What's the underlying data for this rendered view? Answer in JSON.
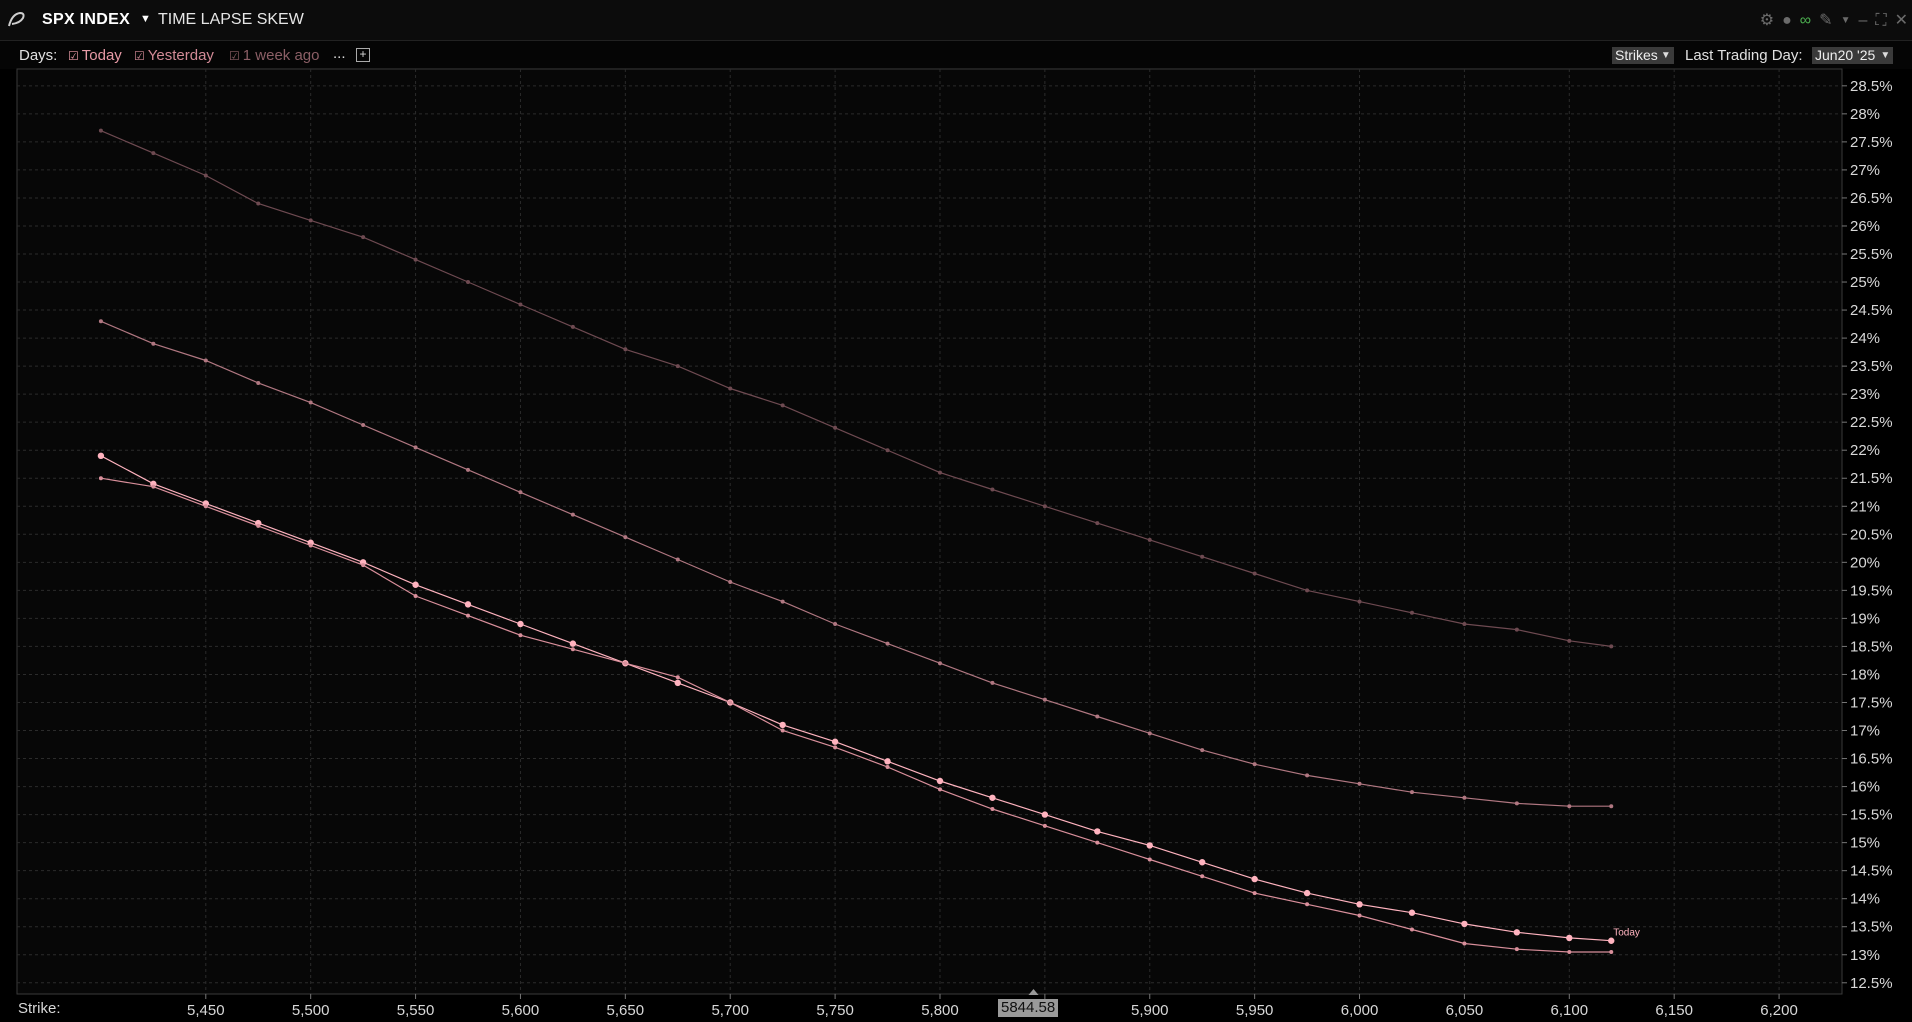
{
  "header": {
    "ticker": "SPX INDEX",
    "panel_title": "TIME LAPSE SKEW",
    "icons": [
      "gear-icon",
      "chat-icon",
      "link-icon",
      "pin-icon",
      "minimize-icon",
      "maximize-icon",
      "close-icon"
    ]
  },
  "toolbar": {
    "days_label": "Days:",
    "days": [
      {
        "label": "Today",
        "checked": true,
        "color": "#e89aa6"
      },
      {
        "label": "Yesterday",
        "checked": true,
        "color": "#d28a96"
      },
      {
        "label": "1 week ago",
        "checked": true,
        "color": "#8c5f66"
      }
    ],
    "more": "...",
    "add_symbol": "+",
    "axis_mode": "Strikes",
    "last_trading_day_label": "Last Trading Day:",
    "last_trading_day_value": "Jun20 '25"
  },
  "footer": {
    "x_axis_label": "Strike:",
    "cursor_value": "5844.58"
  },
  "chart_data": {
    "type": "line",
    "xlabel": "Strike:",
    "ylabel": "",
    "xlim": [
      5360,
      6230
    ],
    "ylim": [
      12.3,
      28.8
    ],
    "x_ticks": [
      5450,
      5500,
      5550,
      5600,
      5650,
      5700,
      5750,
      5800,
      5850,
      5900,
      5950,
      6000,
      6050,
      6100,
      6150,
      6200
    ],
    "x_tick_labels": [
      "5,450",
      "5,500",
      "5,550",
      "5,600",
      "5,650",
      "5,700",
      "5,750",
      "5,800",
      "",
      "5,900",
      "5,950",
      "6,000",
      "6,050",
      "6,100",
      "6,150",
      "6,200"
    ],
    "y_ticks": [
      12.5,
      13,
      13.5,
      14,
      14.5,
      15,
      15.5,
      16,
      16.5,
      17,
      17.5,
      18,
      18.5,
      19,
      19.5,
      20,
      20.5,
      21,
      21.5,
      22,
      22.5,
      23,
      23.5,
      24,
      24.5,
      25,
      25.5,
      26,
      26.5,
      27,
      27.5,
      28,
      28.5
    ],
    "y_tick_labels": [
      "12.5%",
      "13%",
      "13.5%",
      "14%",
      "14.5%",
      "15%",
      "15.5%",
      "16%",
      "16.5%",
      "17%",
      "17.5%",
      "18%",
      "18.5%",
      "19%",
      "19.5%",
      "20%",
      "20.5%",
      "21%",
      "21.5%",
      "22%",
      "22.5%",
      "23%",
      "23.5%",
      "24%",
      "24.5%",
      "25%",
      "25.5%",
      "26%",
      "26.5%",
      "27%",
      "27.5%",
      "28%",
      "28.5%"
    ],
    "grid": true,
    "series": [
      {
        "name": "1 week ago",
        "color": "#6e4a51",
        "x": [
          5400,
          5425,
          5450,
          5475,
          5500,
          5525,
          5550,
          5575,
          5600,
          5625,
          5650,
          5675,
          5700,
          5725,
          5750,
          5775,
          5800,
          5825,
          5850,
          5875,
          5900,
          5925,
          5950,
          5975,
          6000,
          6025,
          6050,
          6075,
          6100,
          6120
        ],
        "y": [
          27.7,
          27.3,
          26.9,
          26.4,
          26.1,
          25.8,
          25.4,
          25.0,
          24.6,
          24.2,
          23.8,
          23.5,
          23.1,
          22.8,
          22.4,
          22.0,
          21.6,
          21.3,
          21.0,
          20.7,
          20.4,
          20.1,
          19.8,
          19.5,
          19.3,
          19.1,
          18.9,
          18.8,
          18.6,
          18.5
        ]
      },
      {
        "name": "Yesterday",
        "color": "#b07781",
        "x": [
          5400,
          5425,
          5450,
          5475,
          5500,
          5525,
          5550,
          5575,
          5600,
          5625,
          5650,
          5675,
          5700,
          5725,
          5750,
          5775,
          5800,
          5825,
          5850,
          5875,
          5900,
          5925,
          5950,
          5975,
          6000,
          6025,
          6050,
          6075,
          6100,
          6120
        ],
        "y": [
          24.3,
          23.9,
          23.6,
          23.2,
          22.85,
          22.45,
          22.05,
          21.65,
          21.25,
          20.85,
          20.45,
          20.05,
          19.65,
          19.3,
          18.9,
          18.55,
          18.2,
          17.85,
          17.55,
          17.25,
          16.95,
          16.65,
          16.4,
          16.2,
          16.05,
          15.9,
          15.8,
          15.7,
          15.65,
          15.65
        ]
      },
      {
        "name": "Today",
        "color": "#ffb3bf",
        "x": [
          5400,
          5425,
          5450,
          5475,
          5500,
          5525,
          5550,
          5575,
          5600,
          5625,
          5650,
          5675,
          5700,
          5725,
          5750,
          5775,
          5800,
          5825,
          5850,
          5875,
          5900,
          5925,
          5950,
          5975,
          6000,
          6025,
          6050,
          6075,
          6100,
          6120
        ],
        "y": [
          21.9,
          21.4,
          21.05,
          20.7,
          20.35,
          20.0,
          19.6,
          19.25,
          18.9,
          18.55,
          18.2,
          17.85,
          17.5,
          17.1,
          16.8,
          16.45,
          16.1,
          15.8,
          15.5,
          15.2,
          14.95,
          14.65,
          14.35,
          14.1,
          13.9,
          13.75,
          13.55,
          13.4,
          13.3,
          13.25
        ]
      },
      {
        "name": "",
        "color": "#d98f9b",
        "x": [
          5400,
          5425,
          5450,
          5475,
          5500,
          5525,
          5550,
          5575,
          5600,
          5625,
          5650,
          5675,
          5700,
          5725,
          5750,
          5775,
          5800,
          5825,
          5850,
          5875,
          5900,
          5925,
          5950,
          5975,
          6000,
          6025,
          6050,
          6075,
          6100,
          6120
        ],
        "y": [
          21.5,
          21.35,
          21.0,
          20.65,
          20.3,
          19.95,
          19.4,
          19.05,
          18.7,
          18.45,
          18.2,
          17.95,
          17.5,
          17.0,
          16.7,
          16.35,
          15.95,
          15.6,
          15.3,
          15.0,
          14.7,
          14.4,
          14.1,
          13.9,
          13.7,
          13.45,
          13.2,
          13.1,
          13.05,
          13.05
        ]
      }
    ],
    "annotations": [
      "Today"
    ]
  }
}
